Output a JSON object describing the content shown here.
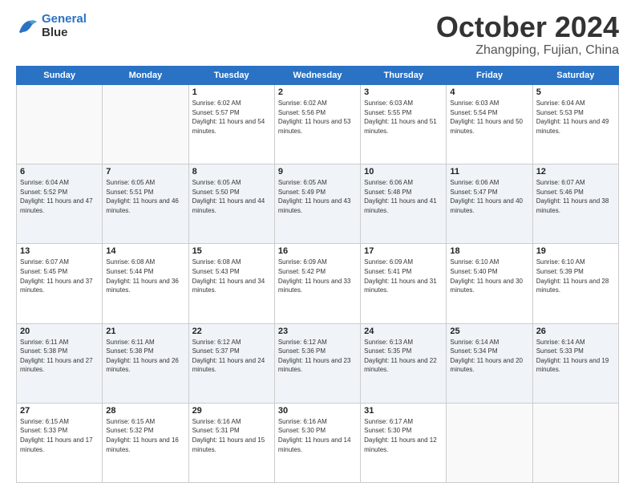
{
  "header": {
    "logo_line1": "General",
    "logo_line2": "Blue",
    "month": "October 2024",
    "location": "Zhangping, Fujian, China"
  },
  "weekdays": [
    "Sunday",
    "Monday",
    "Tuesday",
    "Wednesday",
    "Thursday",
    "Friday",
    "Saturday"
  ],
  "weeks": [
    [
      {
        "day": "",
        "sunrise": "",
        "sunset": "",
        "daylight": ""
      },
      {
        "day": "",
        "sunrise": "",
        "sunset": "",
        "daylight": ""
      },
      {
        "day": "1",
        "sunrise": "Sunrise: 6:02 AM",
        "sunset": "Sunset: 5:57 PM",
        "daylight": "Daylight: 11 hours and 54 minutes."
      },
      {
        "day": "2",
        "sunrise": "Sunrise: 6:02 AM",
        "sunset": "Sunset: 5:56 PM",
        "daylight": "Daylight: 11 hours and 53 minutes."
      },
      {
        "day": "3",
        "sunrise": "Sunrise: 6:03 AM",
        "sunset": "Sunset: 5:55 PM",
        "daylight": "Daylight: 11 hours and 51 minutes."
      },
      {
        "day": "4",
        "sunrise": "Sunrise: 6:03 AM",
        "sunset": "Sunset: 5:54 PM",
        "daylight": "Daylight: 11 hours and 50 minutes."
      },
      {
        "day": "5",
        "sunrise": "Sunrise: 6:04 AM",
        "sunset": "Sunset: 5:53 PM",
        "daylight": "Daylight: 11 hours and 49 minutes."
      }
    ],
    [
      {
        "day": "6",
        "sunrise": "Sunrise: 6:04 AM",
        "sunset": "Sunset: 5:52 PM",
        "daylight": "Daylight: 11 hours and 47 minutes."
      },
      {
        "day": "7",
        "sunrise": "Sunrise: 6:05 AM",
        "sunset": "Sunset: 5:51 PM",
        "daylight": "Daylight: 11 hours and 46 minutes."
      },
      {
        "day": "8",
        "sunrise": "Sunrise: 6:05 AM",
        "sunset": "Sunset: 5:50 PM",
        "daylight": "Daylight: 11 hours and 44 minutes."
      },
      {
        "day": "9",
        "sunrise": "Sunrise: 6:05 AM",
        "sunset": "Sunset: 5:49 PM",
        "daylight": "Daylight: 11 hours and 43 minutes."
      },
      {
        "day": "10",
        "sunrise": "Sunrise: 6:06 AM",
        "sunset": "Sunset: 5:48 PM",
        "daylight": "Daylight: 11 hours and 41 minutes."
      },
      {
        "day": "11",
        "sunrise": "Sunrise: 6:06 AM",
        "sunset": "Sunset: 5:47 PM",
        "daylight": "Daylight: 11 hours and 40 minutes."
      },
      {
        "day": "12",
        "sunrise": "Sunrise: 6:07 AM",
        "sunset": "Sunset: 5:46 PM",
        "daylight": "Daylight: 11 hours and 38 minutes."
      }
    ],
    [
      {
        "day": "13",
        "sunrise": "Sunrise: 6:07 AM",
        "sunset": "Sunset: 5:45 PM",
        "daylight": "Daylight: 11 hours and 37 minutes."
      },
      {
        "day": "14",
        "sunrise": "Sunrise: 6:08 AM",
        "sunset": "Sunset: 5:44 PM",
        "daylight": "Daylight: 11 hours and 36 minutes."
      },
      {
        "day": "15",
        "sunrise": "Sunrise: 6:08 AM",
        "sunset": "Sunset: 5:43 PM",
        "daylight": "Daylight: 11 hours and 34 minutes."
      },
      {
        "day": "16",
        "sunrise": "Sunrise: 6:09 AM",
        "sunset": "Sunset: 5:42 PM",
        "daylight": "Daylight: 11 hours and 33 minutes."
      },
      {
        "day": "17",
        "sunrise": "Sunrise: 6:09 AM",
        "sunset": "Sunset: 5:41 PM",
        "daylight": "Daylight: 11 hours and 31 minutes."
      },
      {
        "day": "18",
        "sunrise": "Sunrise: 6:10 AM",
        "sunset": "Sunset: 5:40 PM",
        "daylight": "Daylight: 11 hours and 30 minutes."
      },
      {
        "day": "19",
        "sunrise": "Sunrise: 6:10 AM",
        "sunset": "Sunset: 5:39 PM",
        "daylight": "Daylight: 11 hours and 28 minutes."
      }
    ],
    [
      {
        "day": "20",
        "sunrise": "Sunrise: 6:11 AM",
        "sunset": "Sunset: 5:38 PM",
        "daylight": "Daylight: 11 hours and 27 minutes."
      },
      {
        "day": "21",
        "sunrise": "Sunrise: 6:11 AM",
        "sunset": "Sunset: 5:38 PM",
        "daylight": "Daylight: 11 hours and 26 minutes."
      },
      {
        "day": "22",
        "sunrise": "Sunrise: 6:12 AM",
        "sunset": "Sunset: 5:37 PM",
        "daylight": "Daylight: 11 hours and 24 minutes."
      },
      {
        "day": "23",
        "sunrise": "Sunrise: 6:12 AM",
        "sunset": "Sunset: 5:36 PM",
        "daylight": "Daylight: 11 hours and 23 minutes."
      },
      {
        "day": "24",
        "sunrise": "Sunrise: 6:13 AM",
        "sunset": "Sunset: 5:35 PM",
        "daylight": "Daylight: 11 hours and 22 minutes."
      },
      {
        "day": "25",
        "sunrise": "Sunrise: 6:14 AM",
        "sunset": "Sunset: 5:34 PM",
        "daylight": "Daylight: 11 hours and 20 minutes."
      },
      {
        "day": "26",
        "sunrise": "Sunrise: 6:14 AM",
        "sunset": "Sunset: 5:33 PM",
        "daylight": "Daylight: 11 hours and 19 minutes."
      }
    ],
    [
      {
        "day": "27",
        "sunrise": "Sunrise: 6:15 AM",
        "sunset": "Sunset: 5:33 PM",
        "daylight": "Daylight: 11 hours and 17 minutes."
      },
      {
        "day": "28",
        "sunrise": "Sunrise: 6:15 AM",
        "sunset": "Sunset: 5:32 PM",
        "daylight": "Daylight: 11 hours and 16 minutes."
      },
      {
        "day": "29",
        "sunrise": "Sunrise: 6:16 AM",
        "sunset": "Sunset: 5:31 PM",
        "daylight": "Daylight: 11 hours and 15 minutes."
      },
      {
        "day": "30",
        "sunrise": "Sunrise: 6:16 AM",
        "sunset": "Sunset: 5:30 PM",
        "daylight": "Daylight: 11 hours and 14 minutes."
      },
      {
        "day": "31",
        "sunrise": "Sunrise: 6:17 AM",
        "sunset": "Sunset: 5:30 PM",
        "daylight": "Daylight: 11 hours and 12 minutes."
      },
      {
        "day": "",
        "sunrise": "",
        "sunset": "",
        "daylight": ""
      },
      {
        "day": "",
        "sunrise": "",
        "sunset": "",
        "daylight": ""
      }
    ]
  ]
}
